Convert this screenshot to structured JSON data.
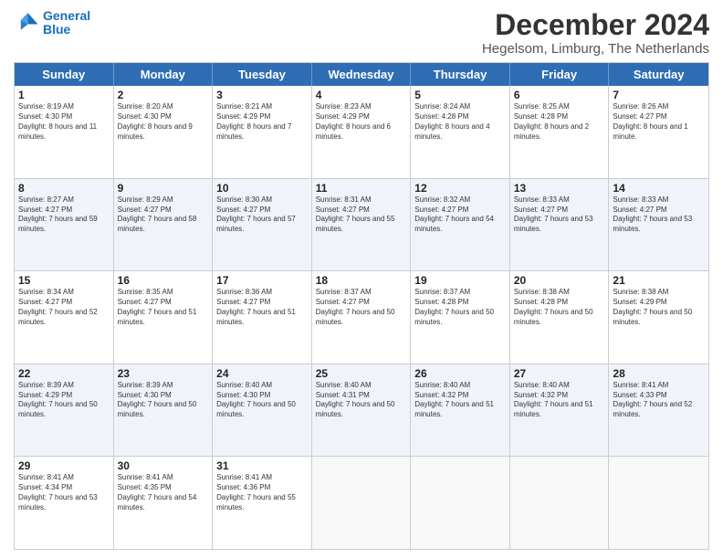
{
  "logo": {
    "line1": "General",
    "line2": "Blue"
  },
  "title": "December 2024",
  "subtitle": "Hegelsom, Limburg, The Netherlands",
  "days_of_week": [
    "Sunday",
    "Monday",
    "Tuesday",
    "Wednesday",
    "Thursday",
    "Friday",
    "Saturday"
  ],
  "weeks": [
    [
      {
        "day": "1",
        "info": "Sunrise: 8:19 AM\nSunset: 4:30 PM\nDaylight: 8 hours and 11 minutes."
      },
      {
        "day": "2",
        "info": "Sunrise: 8:20 AM\nSunset: 4:30 PM\nDaylight: 8 hours and 9 minutes."
      },
      {
        "day": "3",
        "info": "Sunrise: 8:21 AM\nSunset: 4:29 PM\nDaylight: 8 hours and 7 minutes."
      },
      {
        "day": "4",
        "info": "Sunrise: 8:23 AM\nSunset: 4:29 PM\nDaylight: 8 hours and 6 minutes."
      },
      {
        "day": "5",
        "info": "Sunrise: 8:24 AM\nSunset: 4:28 PM\nDaylight: 8 hours and 4 minutes."
      },
      {
        "day": "6",
        "info": "Sunrise: 8:25 AM\nSunset: 4:28 PM\nDaylight: 8 hours and 2 minutes."
      },
      {
        "day": "7",
        "info": "Sunrise: 8:26 AM\nSunset: 4:27 PM\nDaylight: 8 hours and 1 minute."
      }
    ],
    [
      {
        "day": "8",
        "info": "Sunrise: 8:27 AM\nSunset: 4:27 PM\nDaylight: 7 hours and 59 minutes."
      },
      {
        "day": "9",
        "info": "Sunrise: 8:29 AM\nSunset: 4:27 PM\nDaylight: 7 hours and 58 minutes."
      },
      {
        "day": "10",
        "info": "Sunrise: 8:30 AM\nSunset: 4:27 PM\nDaylight: 7 hours and 57 minutes."
      },
      {
        "day": "11",
        "info": "Sunrise: 8:31 AM\nSunset: 4:27 PM\nDaylight: 7 hours and 55 minutes."
      },
      {
        "day": "12",
        "info": "Sunrise: 8:32 AM\nSunset: 4:27 PM\nDaylight: 7 hours and 54 minutes."
      },
      {
        "day": "13",
        "info": "Sunrise: 8:33 AM\nSunset: 4:27 PM\nDaylight: 7 hours and 53 minutes."
      },
      {
        "day": "14",
        "info": "Sunrise: 8:33 AM\nSunset: 4:27 PM\nDaylight: 7 hours and 53 minutes."
      }
    ],
    [
      {
        "day": "15",
        "info": "Sunrise: 8:34 AM\nSunset: 4:27 PM\nDaylight: 7 hours and 52 minutes."
      },
      {
        "day": "16",
        "info": "Sunrise: 8:35 AM\nSunset: 4:27 PM\nDaylight: 7 hours and 51 minutes."
      },
      {
        "day": "17",
        "info": "Sunrise: 8:36 AM\nSunset: 4:27 PM\nDaylight: 7 hours and 51 minutes."
      },
      {
        "day": "18",
        "info": "Sunrise: 8:37 AM\nSunset: 4:27 PM\nDaylight: 7 hours and 50 minutes."
      },
      {
        "day": "19",
        "info": "Sunrise: 8:37 AM\nSunset: 4:28 PM\nDaylight: 7 hours and 50 minutes."
      },
      {
        "day": "20",
        "info": "Sunrise: 8:38 AM\nSunset: 4:28 PM\nDaylight: 7 hours and 50 minutes."
      },
      {
        "day": "21",
        "info": "Sunrise: 8:38 AM\nSunset: 4:29 PM\nDaylight: 7 hours and 50 minutes."
      }
    ],
    [
      {
        "day": "22",
        "info": "Sunrise: 8:39 AM\nSunset: 4:29 PM\nDaylight: 7 hours and 50 minutes."
      },
      {
        "day": "23",
        "info": "Sunrise: 8:39 AM\nSunset: 4:30 PM\nDaylight: 7 hours and 50 minutes."
      },
      {
        "day": "24",
        "info": "Sunrise: 8:40 AM\nSunset: 4:30 PM\nDaylight: 7 hours and 50 minutes."
      },
      {
        "day": "25",
        "info": "Sunrise: 8:40 AM\nSunset: 4:31 PM\nDaylight: 7 hours and 50 minutes."
      },
      {
        "day": "26",
        "info": "Sunrise: 8:40 AM\nSunset: 4:32 PM\nDaylight: 7 hours and 51 minutes."
      },
      {
        "day": "27",
        "info": "Sunrise: 8:40 AM\nSunset: 4:32 PM\nDaylight: 7 hours and 51 minutes."
      },
      {
        "day": "28",
        "info": "Sunrise: 8:41 AM\nSunset: 4:33 PM\nDaylight: 7 hours and 52 minutes."
      }
    ],
    [
      {
        "day": "29",
        "info": "Sunrise: 8:41 AM\nSunset: 4:34 PM\nDaylight: 7 hours and 53 minutes."
      },
      {
        "day": "30",
        "info": "Sunrise: 8:41 AM\nSunset: 4:35 PM\nDaylight: 7 hours and 54 minutes."
      },
      {
        "day": "31",
        "info": "Sunrise: 8:41 AM\nSunset: 4:36 PM\nDaylight: 7 hours and 55 minutes."
      },
      {
        "day": "",
        "info": ""
      },
      {
        "day": "",
        "info": ""
      },
      {
        "day": "",
        "info": ""
      },
      {
        "day": "",
        "info": ""
      }
    ]
  ]
}
